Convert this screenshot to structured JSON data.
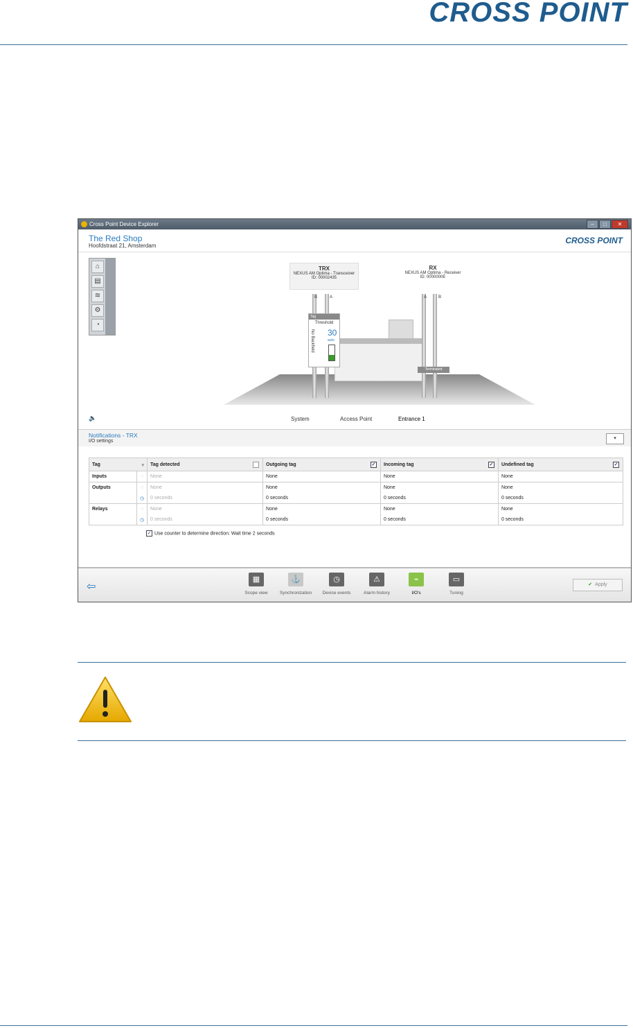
{
  "document": {
    "brand": "CROSS POINT"
  },
  "window": {
    "title": "Cross Point Device Explorer",
    "buttons": {
      "minimize": "–",
      "maximize": "□",
      "close": "✕"
    },
    "shop_name": "The Red Shop",
    "shop_address": "Hoofdstraat 21, Amsterdam",
    "logo": "CROSS POINT"
  },
  "scene": {
    "trx": {
      "name": "TRX",
      "model": "NEXUS AM Optima - Transceiver",
      "id": "ID: 00002435",
      "antenna_left": "B",
      "antenna_right": "A"
    },
    "rx": {
      "name": "RX",
      "model": "NEXUS AM Optima - Receiver",
      "id": "ID: 0000000E",
      "antenna_left": "A",
      "antenna_right": "B"
    },
    "tag_widget": {
      "header": "Tag",
      "threshold_label": "Threshold",
      "threshold_value": "30",
      "mode": "auto",
      "status": "No Backfield",
      "level": 0.35
    },
    "terminated_label": "Terminated"
  },
  "tabs": [
    "System",
    "Access Point",
    "Entrance 1"
  ],
  "notifications": {
    "title": "Notifications - TRX",
    "subtitle": "I/O settings"
  },
  "io_table": {
    "headers": [
      "Tag",
      "Tag detected",
      "Outgoing tag",
      "Incoming tag",
      "Undefined tag"
    ],
    "header_checked": [
      false,
      true,
      true,
      true
    ],
    "groups": [
      {
        "label": "Inputs",
        "rows": [
          [
            "None",
            "None",
            "None",
            "None"
          ]
        ]
      },
      {
        "label": "Outputs",
        "rows": [
          [
            "None",
            "None",
            "None",
            "None"
          ],
          [
            "0 seconds",
            "0 seconds",
            "0 seconds",
            "0 seconds"
          ]
        ]
      },
      {
        "label": "Relays",
        "rows": [
          [
            "None",
            "None",
            "None",
            "None"
          ],
          [
            "0 seconds",
            "0 seconds",
            "0 seconds",
            "0 seconds"
          ]
        ]
      }
    ],
    "counter_option": "Use counter to determine direction: Wait time  2 seconds"
  },
  "toolbar": {
    "items": [
      "Scope view",
      "Synchronization",
      "Device events",
      "Alarm history",
      "I/O's",
      "Tuning"
    ],
    "apply": "Apply"
  },
  "colors": {
    "accent": "#2a7bbf",
    "brand": "#1f5c8e",
    "warning": "#f2c200"
  }
}
